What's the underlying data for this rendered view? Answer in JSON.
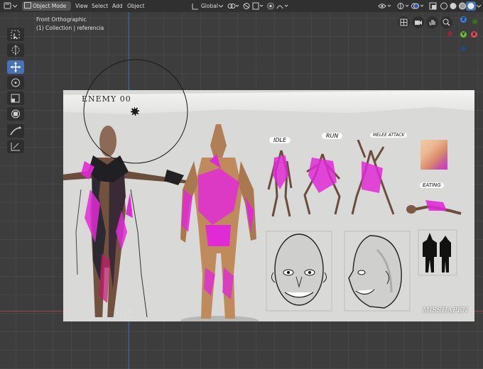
{
  "header": {
    "mode": "Object Mode",
    "menus": [
      "View",
      "Select",
      "Add",
      "Object"
    ],
    "orientation": "Global"
  },
  "viewport": {
    "view_name": "Front Orthographic",
    "collection_info": "(1) Collection | referencia"
  },
  "reference": {
    "title": "ENEMY 00",
    "labels": {
      "idle": "IDLE",
      "run": "RUN",
      "melee": "MELEE ATTACK",
      "eating": "EATING"
    },
    "signature": "MISSHAPEN"
  },
  "gizmo": {
    "axes": [
      "Z",
      "X",
      "Y"
    ]
  },
  "colors": {
    "accent": "#4772b3",
    "mesh": "#e02ad6",
    "x_axis": "#e84a5f",
    "y_axis": "#6fba2c",
    "z_axis": "#3b82e0"
  },
  "toolbar_tools": [
    "select-box",
    "cursor",
    "move",
    "rotate",
    "scale",
    "transform",
    "annotate",
    "measure"
  ]
}
